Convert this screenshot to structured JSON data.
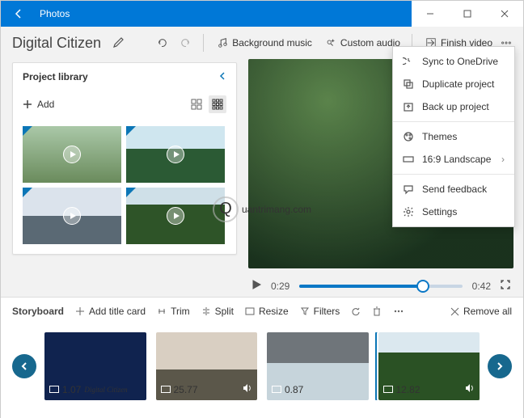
{
  "window": {
    "title": "Photos"
  },
  "project": {
    "name": "Digital Citizen"
  },
  "toolbar": {
    "background_music": "Background music",
    "custom_audio": "Custom audio",
    "finish_video": "Finish video"
  },
  "library": {
    "title": "Project library",
    "add": "Add"
  },
  "player": {
    "current": "0:29",
    "total": "0:42"
  },
  "storyboard": {
    "title": "Storyboard",
    "add_title_card": "Add title card",
    "trim": "Trim",
    "split": "Split",
    "resize": "Resize",
    "filters": "Filters",
    "remove_all": "Remove all",
    "clips": [
      "1.07",
      "25.77",
      "0.87",
      "12.82"
    ]
  },
  "menu": {
    "sync": "Sync to OneDrive",
    "duplicate": "Duplicate project",
    "backup": "Back up project",
    "themes": "Themes",
    "aspect": "16:9 Landscape",
    "feedback": "Send feedback",
    "settings": "Settings"
  },
  "watermark": "uantrimang.com"
}
